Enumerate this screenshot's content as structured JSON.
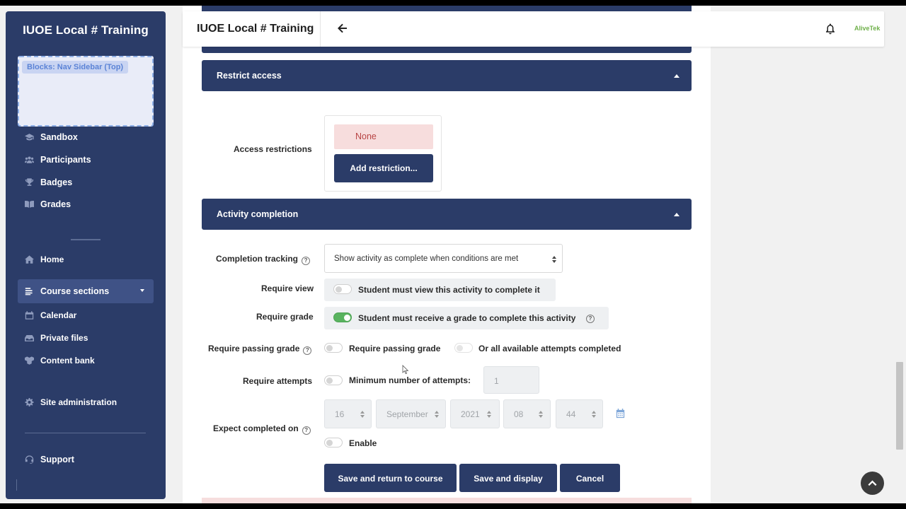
{
  "sidebar": {
    "title": "IUOE Local # Training",
    "block_label": "Blocks: Nav Sidebar (Top)",
    "items": [
      {
        "label": "Sandbox",
        "icon": "graduation-cap-icon"
      },
      {
        "label": "Participants",
        "icon": "users-icon"
      },
      {
        "label": "Badges",
        "icon": "trophy-icon"
      },
      {
        "label": "Grades",
        "icon": "book-icon"
      }
    ],
    "nav": [
      {
        "label": "Home",
        "icon": "home-icon"
      },
      {
        "label": "Course sections",
        "icon": "list-icon"
      },
      {
        "label": "Calendar",
        "icon": "calendar-icon"
      },
      {
        "label": "Private files",
        "icon": "files-icon"
      },
      {
        "label": "Content bank",
        "icon": "cubes-icon"
      },
      {
        "label": "Site administration",
        "icon": "gear-icon"
      },
      {
        "label": "Support",
        "icon": "headset-icon"
      }
    ]
  },
  "topbar": {
    "title": "IUOE Local # Training",
    "logo_text": "AliveTek"
  },
  "restrict": {
    "section_title": "Restrict access",
    "label": "Access restrictions",
    "none_text": "None",
    "add_button": "Add restriction..."
  },
  "completion": {
    "section_title": "Activity completion",
    "tracking_label": "Completion tracking",
    "tracking_value": "Show activity as complete when conditions are met",
    "require_view_label": "Require view",
    "require_view_text": "Student must view this activity to complete it",
    "require_grade_label": "Require grade",
    "require_grade_text": "Student must receive a grade to complete this activity",
    "require_passing_label": "Require passing grade",
    "require_passing_text": "Require passing grade",
    "all_attempts_text": "Or all available attempts completed",
    "require_attempts_label": "Require attempts",
    "min_attempts_text": "Minimum number of attempts:",
    "min_attempts_value": "1",
    "expect_label": "Expect completed on",
    "date": {
      "day": "16",
      "month": "September",
      "year": "2021",
      "hour": "08",
      "minute": "44"
    },
    "enable_text": "Enable"
  },
  "buttons": {
    "save_return": "Save and return to course",
    "save_display": "Save and display",
    "cancel": "Cancel"
  },
  "colors": {
    "navy": "#2b3c68",
    "toggle_on": "#59b35f",
    "none_bg": "#f7dddd"
  }
}
